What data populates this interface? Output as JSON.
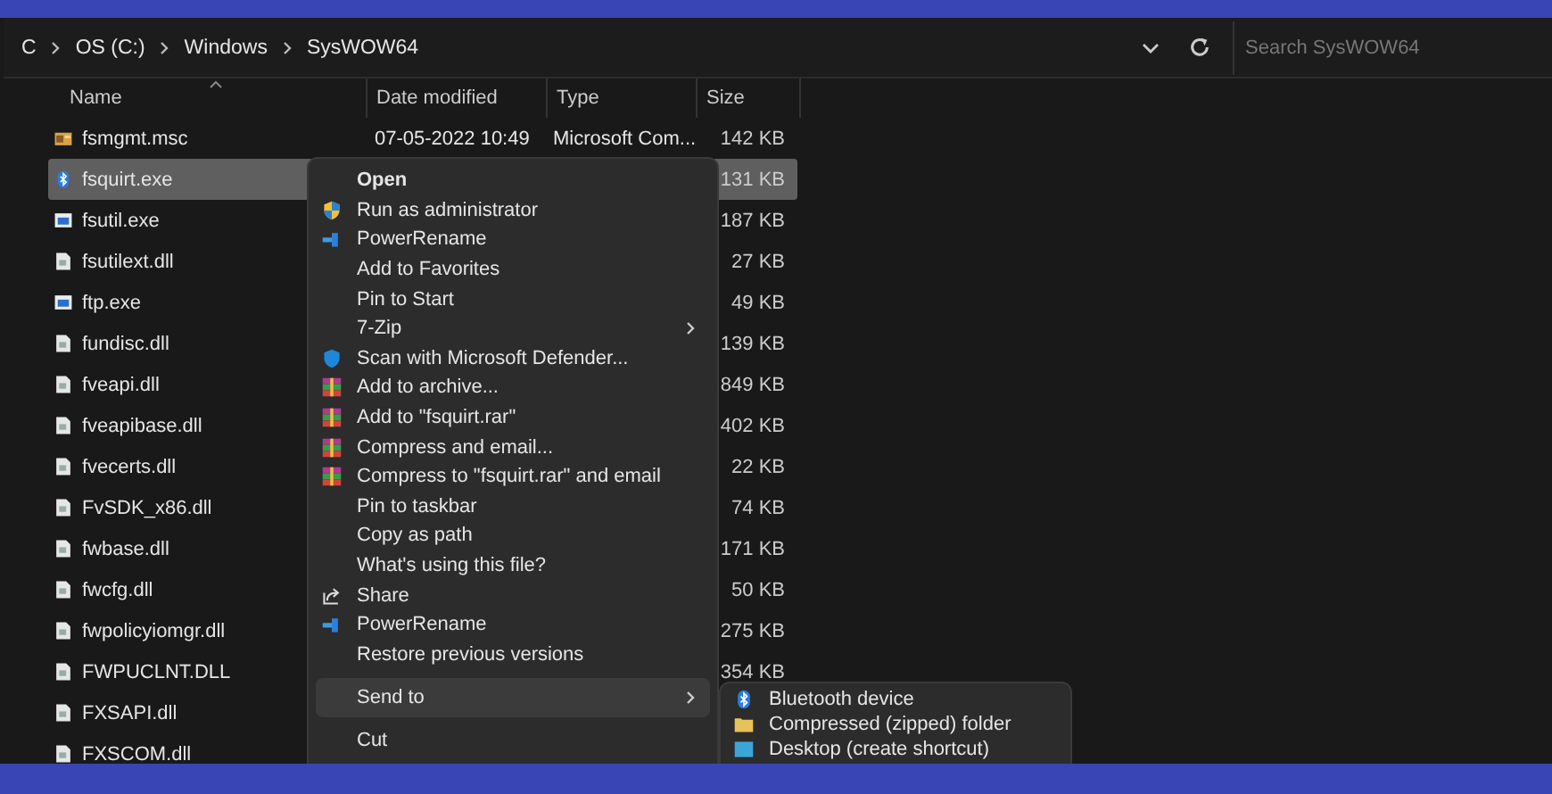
{
  "address_bar": {
    "breadcrumb": [
      "C",
      "OS (C:)",
      "Windows",
      "SysWOW64"
    ]
  },
  "search": {
    "placeholder": "Search SysWOW64"
  },
  "columns": [
    "Name",
    "Date modified",
    "Type",
    "Size"
  ],
  "files": [
    {
      "name": "fsmgmt.msc",
      "kind": "msc",
      "date": "07-05-2022 10:49",
      "type": "Microsoft Com...",
      "size": "142 KB",
      "selected": false
    },
    {
      "name": "fsquirt.exe",
      "kind": "bluetooth",
      "size": "131 KB",
      "selected": true
    },
    {
      "name": "fsutil.exe",
      "kind": "exe",
      "size": "187 KB",
      "selected": false
    },
    {
      "name": "fsutilext.dll",
      "kind": "dll",
      "size": "27 KB",
      "selected": false
    },
    {
      "name": "ftp.exe",
      "kind": "exe",
      "size": "49 KB",
      "selected": false
    },
    {
      "name": "fundisc.dll",
      "kind": "dll",
      "size": "139 KB",
      "selected": false
    },
    {
      "name": "fveapi.dll",
      "kind": "dll",
      "size": "849 KB",
      "selected": false
    },
    {
      "name": "fveapibase.dll",
      "kind": "dll",
      "size": "402 KB",
      "selected": false
    },
    {
      "name": "fvecerts.dll",
      "kind": "dll",
      "size": "22 KB",
      "selected": false
    },
    {
      "name": "FvSDK_x86.dll",
      "kind": "dll",
      "size": "74 KB",
      "selected": false
    },
    {
      "name": "fwbase.dll",
      "kind": "dll",
      "size": "171 KB",
      "selected": false
    },
    {
      "name": "fwcfg.dll",
      "kind": "dll",
      "size": "50 KB",
      "selected": false
    },
    {
      "name": "fwpolicyiomgr.dll",
      "kind": "dll",
      "size": "275 KB",
      "selected": false
    },
    {
      "name": "FWPUCLNT.DLL",
      "kind": "dll",
      "size": "354 KB",
      "selected": false
    },
    {
      "name": "FXSAPI.dll",
      "kind": "dll",
      "selected": false
    },
    {
      "name": "FXSCOM.dll",
      "kind": "dll",
      "selected": false
    }
  ],
  "context_menu": [
    {
      "label": "Open",
      "kind": "default",
      "submenu": false,
      "selected": false
    },
    {
      "label": "Run as administrator",
      "kind": "admin",
      "submenu": false,
      "selected": false
    },
    {
      "label": "PowerRename",
      "kind": "powertoy",
      "submenu": false,
      "selected": false
    },
    {
      "label": "Add to Favorites",
      "kind": "plain",
      "submenu": false,
      "selected": false
    },
    {
      "label": "Pin to Start",
      "kind": "plain",
      "submenu": false,
      "selected": false
    },
    {
      "label": "7-Zip",
      "kind": "plain",
      "submenu": true,
      "selected": false
    },
    {
      "label": "Scan with Microsoft Defender...",
      "kind": "defender",
      "submenu": false,
      "selected": false
    },
    {
      "label": "Add to archive...",
      "kind": "archive",
      "submenu": false,
      "selected": false
    },
    {
      "label": "Add to \"fsquirt.rar\"",
      "kind": "archive",
      "submenu": false,
      "selected": false
    },
    {
      "label": "Compress and email...",
      "kind": "archive",
      "submenu": false,
      "selected": false
    },
    {
      "label": "Compress to \"fsquirt.rar\" and email",
      "kind": "archive",
      "submenu": false,
      "selected": false
    },
    {
      "label": "Pin to taskbar",
      "kind": "plain",
      "submenu": false,
      "selected": false
    },
    {
      "label": "Copy as path",
      "kind": "plain",
      "submenu": false,
      "selected": false
    },
    {
      "label": "What's using this file?",
      "kind": "plain",
      "submenu": false,
      "selected": false
    },
    {
      "label": "Share",
      "kind": "share",
      "submenu": false,
      "selected": false
    },
    {
      "label": "PowerRename",
      "kind": "powertoy",
      "submenu": false,
      "selected": false
    },
    {
      "label": "Restore previous versions",
      "kind": "plain",
      "submenu": false,
      "selected": false
    },
    {
      "kind": "separator"
    },
    {
      "label": "Send to",
      "kind": "plain",
      "submenu": true,
      "selected": true
    },
    {
      "kind": "separator"
    },
    {
      "label": "Cut",
      "kind": "plain",
      "submenu": false,
      "selected": false
    }
  ],
  "send_to_menu": [
    {
      "label": "Bluetooth device",
      "kind": "bluetooth"
    },
    {
      "label": "Compressed (zipped) folder",
      "kind": "folder"
    },
    {
      "label": "Desktop (create shortcut)",
      "kind": "desktop"
    }
  ]
}
